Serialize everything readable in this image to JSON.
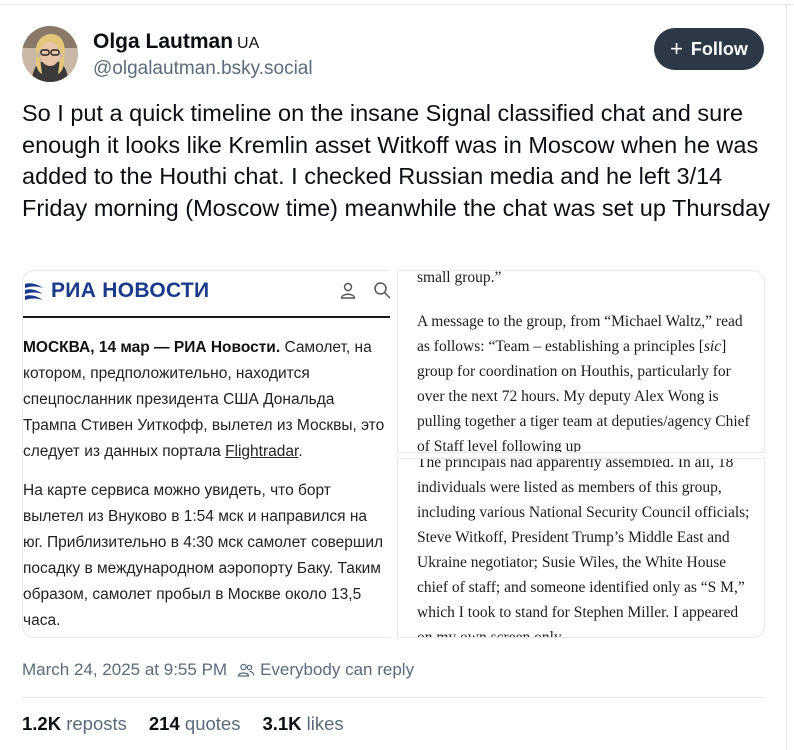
{
  "author": {
    "display_name": "Olga Lautman",
    "flag": "UA",
    "handle": "@olgalautman.bsky.social"
  },
  "follow_button": {
    "icon": "plus-icon",
    "label": "Follow"
  },
  "post": {
    "text": "So I put a quick timeline on the insane Signal classified chat and sure enough it looks like Kremlin asset Witkoff was in Moscow when he was added to the Houthi chat. I checked Russian media and he left 3/14 Friday morning (Moscow time) meanwhile the chat was set up Thursday"
  },
  "image_ria": {
    "logo_text": "РИА НОВОСТИ",
    "dateline": "МОСКВА, 14 мар — РИА Новости.",
    "p1_text": " Самолет, на котором, предположительно, находится спецпосланник президента США Дональда Трампа Стивен Уиткофф, вылетел из Москвы, это следует из данных портала ",
    "p1_link": "Flightradar",
    "p1_end": ".",
    "p2": "На карте сервиса можно увидеть, что борт вылетел из Внуково в 1:54 мск и направился на юг. Приблизительно в 4:30 мск самолет совершил посадку в международном аэропорту Баку. Таким образом, самолет пробыл в Москве около 13,5 часа.",
    "brand_color": "#1a3a8c"
  },
  "image_book_top": {
    "line_top": "small group.”",
    "para_before_sic": "A message to the group, from “Michael Waltz,” read as follows: “Team – establishing a principles [",
    "sic": "sic",
    "para_after_sic": "] group for coordination on Houthis, particularly for over the next 72 hours. My deputy Alex Wong is pulling together a tiger team at deputies/agency Chief of Staff level following up"
  },
  "image_book_bottom": {
    "text": "The principals had apparently assembled. In all, 18 individuals were listed as members of this group, including various National Security Council officials; Steve Witkoff, President Trump’s Middle East and Ukraine negotiator; Susie Wiles, the White House chief of staff; and someone identified only as “S M,” which I took to stand for Stephen Miller. I appeared on my own screen only"
  },
  "meta": {
    "timestamp": "March 24, 2025 at 9:55 PM",
    "reply_icon": "people-icon",
    "reply_setting": "Everybody can reply"
  },
  "stats": {
    "reposts_count": "1.2K",
    "reposts_label": "reposts",
    "quotes_count": "214",
    "quotes_label": "quotes",
    "likes_count": "3.1K",
    "likes_label": "likes"
  }
}
